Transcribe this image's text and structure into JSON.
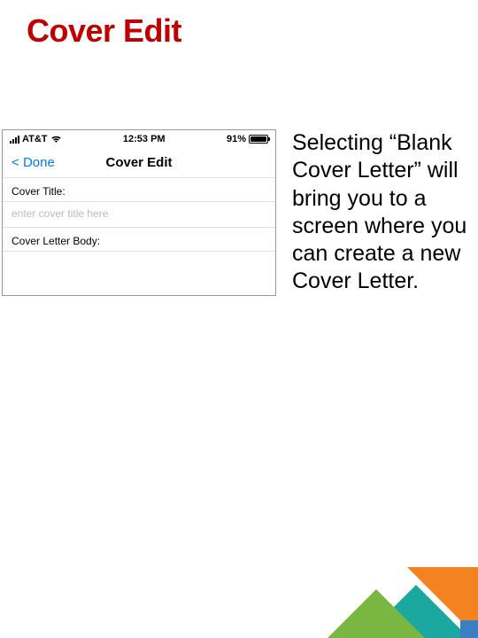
{
  "slide": {
    "title": "Cover Edit",
    "description": "Selecting “Blank Cover Letter” will bring you to a screen where you can create a new Cover Letter."
  },
  "phone": {
    "status": {
      "carrier": "AT&T",
      "time": "12:53 PM",
      "battery_pct": "91%",
      "battery_fill_pct": 91
    },
    "nav": {
      "back": "Done",
      "title": "Cover Edit"
    },
    "fields": {
      "cover_title_label": "Cover Title:",
      "cover_title_placeholder": "enter cover title here",
      "cover_body_label": "Cover Letter Body:"
    }
  },
  "colors": {
    "title": "#c00000",
    "ios_blue": "#007aff",
    "orange": "#f58220",
    "teal": "#1ba8a0",
    "green": "#7ab642",
    "blue": "#3a7fc2"
  }
}
